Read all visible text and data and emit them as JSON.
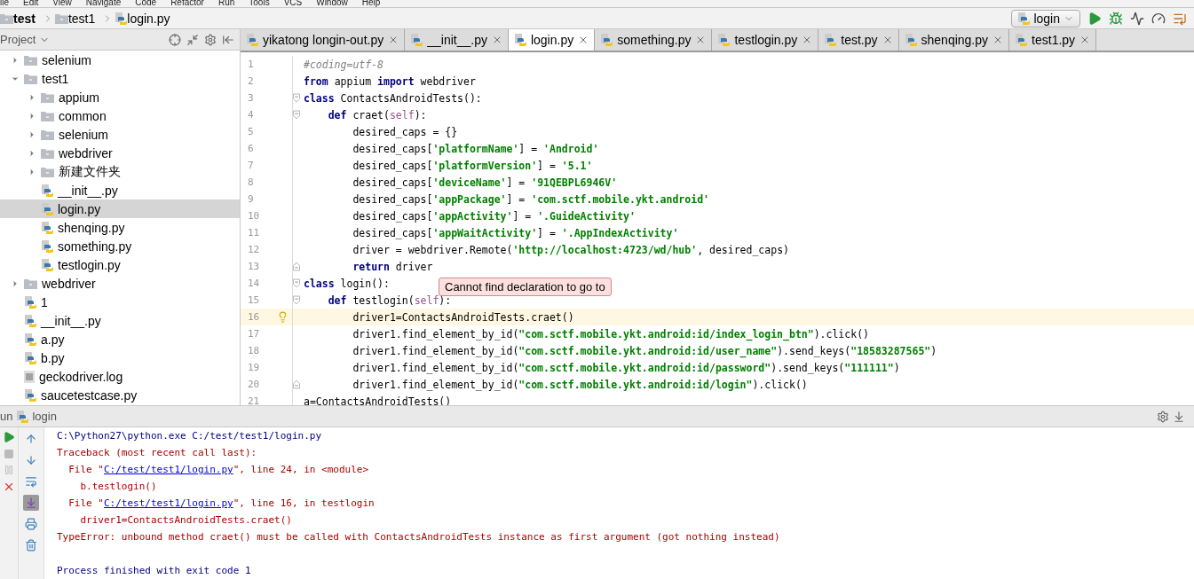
{
  "menu": [
    "ile",
    "Edit",
    "View",
    "Navigate",
    "Code",
    "Refactor",
    "Run",
    "Tools",
    "VCS",
    "Window",
    "Help"
  ],
  "breadcrumbs": [
    {
      "label": "test",
      "kind": "project"
    },
    {
      "label": "test1",
      "kind": "folder"
    },
    {
      "label": "login.py",
      "kind": "python"
    }
  ],
  "run_config": {
    "label": "login"
  },
  "project_panel": {
    "title": "Project",
    "tree": [
      {
        "label": "selenium",
        "kind": "folder",
        "expanded": false,
        "selected": false
      },
      {
        "label": "test1",
        "kind": "folder",
        "expanded": true,
        "selected": false,
        "children": [
          {
            "label": "appium",
            "kind": "folder",
            "expanded": false,
            "selected": false
          },
          {
            "label": "common",
            "kind": "folder",
            "expanded": false,
            "selected": false
          },
          {
            "label": "selenium",
            "kind": "folder",
            "expanded": false,
            "selected": false
          },
          {
            "label": "webdriver",
            "kind": "folder",
            "expanded": false,
            "selected": false
          },
          {
            "label": "新建文件夹",
            "kind": "folder",
            "expanded": false,
            "selected": false
          },
          {
            "label": "__init__.py",
            "kind": "python",
            "selected": false
          },
          {
            "label": "login.py",
            "kind": "python",
            "selected": true
          },
          {
            "label": "shenqing.py",
            "kind": "python",
            "selected": false
          },
          {
            "label": "something.py",
            "kind": "python",
            "selected": false
          },
          {
            "label": "testlogin.py",
            "kind": "python",
            "selected": false
          }
        ]
      },
      {
        "label": "webdriver",
        "kind": "folder",
        "expanded": false,
        "selected": false
      },
      {
        "label": "1",
        "kind": "python",
        "selected": false
      },
      {
        "label": "__init__.py",
        "kind": "python",
        "selected": false
      },
      {
        "label": "a.py",
        "kind": "python",
        "selected": false
      },
      {
        "label": "b.py",
        "kind": "python",
        "selected": false
      },
      {
        "label": "geckodriver.log",
        "kind": "log",
        "selected": false
      },
      {
        "label": "saucetestcase.py",
        "kind": "python",
        "selected": false
      }
    ]
  },
  "tabs": [
    {
      "label": "yikatong longin-out.py",
      "selected": false
    },
    {
      "label": "__init__.py",
      "selected": false
    },
    {
      "label": "login.py",
      "selected": true
    },
    {
      "label": "something.py",
      "selected": false
    },
    {
      "label": "testlogin.py",
      "selected": false
    },
    {
      "label": "test.py",
      "selected": false
    },
    {
      "label": "shenqing.py",
      "selected": false
    },
    {
      "label": "test1.py",
      "selected": false
    }
  ],
  "editor": {
    "tooltip": "Cannot find declaration to go to",
    "lines": [
      {
        "number": "1",
        "current": false,
        "tokens": [
          {
            "text": "#coding=utf-8",
            "kind": "comment"
          }
        ]
      },
      {
        "number": "2",
        "current": false,
        "tokens": [
          {
            "text": "from",
            "kind": "keyword"
          },
          {
            "text": " appium ",
            "kind": "plain"
          },
          {
            "text": "import",
            "kind": "keyword"
          },
          {
            "text": " webdriver",
            "kind": "plain"
          }
        ]
      },
      {
        "number": "3",
        "current": false,
        "fold": {
          "kind": "open"
        },
        "tokens": [
          {
            "text": "class",
            "kind": "keyword"
          },
          {
            "text": " ContactsAndroidTests():",
            "kind": "plain"
          }
        ]
      },
      {
        "number": "4",
        "current": false,
        "fold": {
          "kind": "open"
        },
        "tokens": [
          {
            "text": "    def",
            "kind": "keyword"
          },
          {
            "text": " craet(",
            "kind": "plain"
          },
          {
            "text": "self",
            "kind": "self"
          },
          {
            "text": "):",
            "kind": "plain"
          }
        ]
      },
      {
        "number": "5",
        "current": false,
        "tokens": [
          {
            "text": "        desired_caps = {}",
            "kind": "plain"
          }
        ]
      },
      {
        "number": "6",
        "current": false,
        "tokens": [
          {
            "text": "        desired_caps[",
            "kind": "plain"
          },
          {
            "text": "'platformName'",
            "kind": "string"
          },
          {
            "text": "] = ",
            "kind": "plain"
          },
          {
            "text": "'Android'",
            "kind": "string"
          }
        ]
      },
      {
        "number": "7",
        "current": false,
        "tokens": [
          {
            "text": "        desired_caps[",
            "kind": "plain"
          },
          {
            "text": "'platformVersion'",
            "kind": "string"
          },
          {
            "text": "] = ",
            "kind": "plain"
          },
          {
            "text": "'5.1'",
            "kind": "string"
          }
        ]
      },
      {
        "number": "8",
        "current": false,
        "tokens": [
          {
            "text": "        desired_caps[",
            "kind": "plain"
          },
          {
            "text": "'deviceName'",
            "kind": "string"
          },
          {
            "text": "] = ",
            "kind": "plain"
          },
          {
            "text": "'91QEBPL6946V'",
            "kind": "string"
          }
        ]
      },
      {
        "number": "9",
        "current": false,
        "tokens": [
          {
            "text": "        desired_caps[",
            "kind": "plain"
          },
          {
            "text": "'appPackage'",
            "kind": "string"
          },
          {
            "text": "] = ",
            "kind": "plain"
          },
          {
            "text": "'com.sctf.mobile.ykt.android'",
            "kind": "string"
          }
        ]
      },
      {
        "number": "10",
        "current": false,
        "tokens": [
          {
            "text": "        desired_caps[",
            "kind": "plain"
          },
          {
            "text": "'appActivity'",
            "kind": "string"
          },
          {
            "text": "] = ",
            "kind": "plain"
          },
          {
            "text": "'.GuideActivity'",
            "kind": "string"
          }
        ]
      },
      {
        "number": "11",
        "current": false,
        "tokens": [
          {
            "text": "        desired_caps[",
            "kind": "plain"
          },
          {
            "text": "'appWaitActivity'",
            "kind": "string"
          },
          {
            "text": "] = ",
            "kind": "plain"
          },
          {
            "text": "'.AppIndexActivity'",
            "kind": "string"
          }
        ]
      },
      {
        "number": "12",
        "current": false,
        "tokens": [
          {
            "text": "        driver = webdriver.Remote(",
            "kind": "plain"
          },
          {
            "text": "'http://localhost:4723/wd/hub'",
            "kind": "string"
          },
          {
            "text": ", desired_caps)",
            "kind": "plain"
          }
        ]
      },
      {
        "number": "13",
        "current": false,
        "fold": {
          "kind": "close"
        },
        "tokens": [
          {
            "text": "        return",
            "kind": "keyword"
          },
          {
            "text": " driver",
            "kind": "plain"
          }
        ]
      },
      {
        "number": "14",
        "current": false,
        "fold": {
          "kind": "open"
        },
        "tokens": [
          {
            "text": "class",
            "kind": "keyword"
          },
          {
            "text": " login():",
            "kind": "plain"
          }
        ]
      },
      {
        "number": "15",
        "current": false,
        "fold": {
          "kind": "open"
        },
        "tokens": [
          {
            "text": "    def",
            "kind": "keyword"
          },
          {
            "text": " testlogin(",
            "kind": "plain"
          },
          {
            "text": "self",
            "kind": "self"
          },
          {
            "text": "):",
            "kind": "plain"
          }
        ]
      },
      {
        "number": "16",
        "current": true,
        "tokens": [
          {
            "text": "        driver1=ContactsAndroidTests.craet()",
            "kind": "plain"
          }
        ]
      },
      {
        "number": "17",
        "current": false,
        "tokens": [
          {
            "text": "        driver1.find_element_by_id(",
            "kind": "plain"
          },
          {
            "text": "\"com.sctf.mobile.ykt.android:id/index_login_btn\"",
            "kind": "string"
          },
          {
            "text": ").click()",
            "kind": "plain"
          }
        ]
      },
      {
        "number": "18",
        "current": false,
        "tokens": [
          {
            "text": "        driver1.find_element_by_id(",
            "kind": "plain"
          },
          {
            "text": "\"com.sctf.mobile.ykt.android:id/user_name\"",
            "kind": "string"
          },
          {
            "text": ").send_keys(",
            "kind": "plain"
          },
          {
            "text": "\"18583287565\"",
            "kind": "string"
          },
          {
            "text": ")",
            "kind": "plain"
          }
        ]
      },
      {
        "number": "19",
        "current": false,
        "tokens": [
          {
            "text": "        driver1.find_element_by_id(",
            "kind": "plain"
          },
          {
            "text": "\"com.sctf.mobile.ykt.android:id/password\"",
            "kind": "string"
          },
          {
            "text": ").send_keys(",
            "kind": "plain"
          },
          {
            "text": "\"111111\"",
            "kind": "string"
          },
          {
            "text": ")",
            "kind": "plain"
          }
        ]
      },
      {
        "number": "20",
        "current": false,
        "fold": {
          "kind": "close"
        },
        "tokens": [
          {
            "text": "        driver1.find_element_by_id(",
            "kind": "plain"
          },
          {
            "text": "\"com.sctf.mobile.ykt.android:id/login\"",
            "kind": "string"
          },
          {
            "text": ").click()",
            "kind": "plain"
          }
        ]
      },
      {
        "number": "21",
        "current": false,
        "tokens": [
          {
            "text": "a=ContactsAndroidTests()",
            "kind": "plain"
          }
        ]
      }
    ]
  },
  "run_panel": {
    "title": "un",
    "config": "login",
    "console": [
      {
        "kind": "command",
        "tokens": [
          {
            "text": "C:\\Python27\\python.exe C:/test/test1/login.py",
            "kind": "plain"
          }
        ]
      },
      {
        "kind": "error",
        "tokens": [
          {
            "text": "Traceback (most recent call last):",
            "kind": "plain"
          }
        ]
      },
      {
        "kind": "error",
        "tokens": [
          {
            "text": "  File \"",
            "kind": "plain"
          },
          {
            "text": "C:/test/test1/login.py",
            "kind": "link"
          },
          {
            "text": "\", line 24, in <module>",
            "kind": "plain"
          }
        ]
      },
      {
        "kind": "error",
        "tokens": [
          {
            "text": "    b.testlogin()",
            "kind": "plain"
          }
        ]
      },
      {
        "kind": "error",
        "tokens": [
          {
            "text": "  File \"",
            "kind": "plain"
          },
          {
            "text": "C:/test/test1/login.py",
            "kind": "link"
          },
          {
            "text": "\", line 16, in testlogin",
            "kind": "plain"
          }
        ]
      },
      {
        "kind": "error",
        "tokens": [
          {
            "text": "    driver1=ContactsAndroidTests.craet()",
            "kind": "plain"
          }
        ]
      },
      {
        "kind": "error",
        "tokens": [
          {
            "text": "TypeError: unbound method craet() must be called with ContactsAndroidTests instance as first argument (got nothing instead)",
            "kind": "plain"
          }
        ]
      },
      {
        "kind": "blank"
      },
      {
        "kind": "command",
        "tokens": [
          {
            "text": "Process finished with exit code 1",
            "kind": "plain"
          }
        ]
      }
    ]
  }
}
